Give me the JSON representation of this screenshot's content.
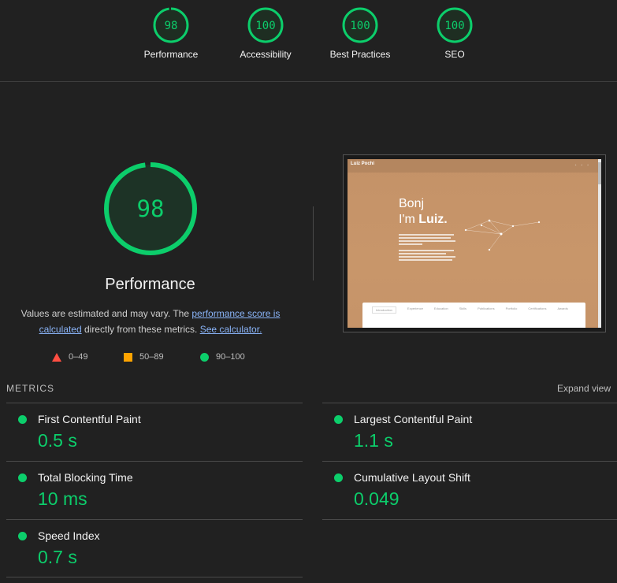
{
  "top_gauges": [
    {
      "score": "98",
      "label": "Performance"
    },
    {
      "score": "100",
      "label": "Accessibility"
    },
    {
      "score": "100",
      "label": "Best Practices"
    },
    {
      "score": "100",
      "label": "SEO"
    }
  ],
  "main": {
    "score": "98",
    "score_fraction": 0.98,
    "title": "Performance",
    "desc_prefix": "Values are estimated and may vary. The ",
    "desc_link1": "performance score is calculated",
    "desc_mid": " directly from these metrics. ",
    "desc_link2": "See calculator."
  },
  "legend": [
    {
      "icon": "triangle-red",
      "range": "0–49"
    },
    {
      "icon": "square-orange",
      "range": "50–89"
    },
    {
      "icon": "circle-green",
      "range": "90–100"
    }
  ],
  "thumbnail": {
    "logo": "Luiz Pochi",
    "heading_line1": "Bonj",
    "heading_line2_prefix": "I'm ",
    "heading_line2_name": "Luiz.",
    "tabs": [
      "Introduction",
      "Experience",
      "Education",
      "Skills",
      "Publications",
      "Portfolio",
      "Certifications",
      "Awards"
    ]
  },
  "metrics": {
    "heading": "METRICS",
    "expand_label": "Expand view",
    "items": [
      {
        "name": "First Contentful Paint",
        "value": "0.5 s"
      },
      {
        "name": "Largest Contentful Paint",
        "value": "1.1 s"
      },
      {
        "name": "Total Blocking Time",
        "value": "10 ms"
      },
      {
        "name": "Cumulative Layout Shift",
        "value": "0.049"
      },
      {
        "name": "Speed Index",
        "value": "0.7 s"
      }
    ]
  },
  "colors": {
    "pass": "#0cce6b",
    "average": "#ffa400",
    "fail": "#ff4e42",
    "background": "#212121"
  }
}
